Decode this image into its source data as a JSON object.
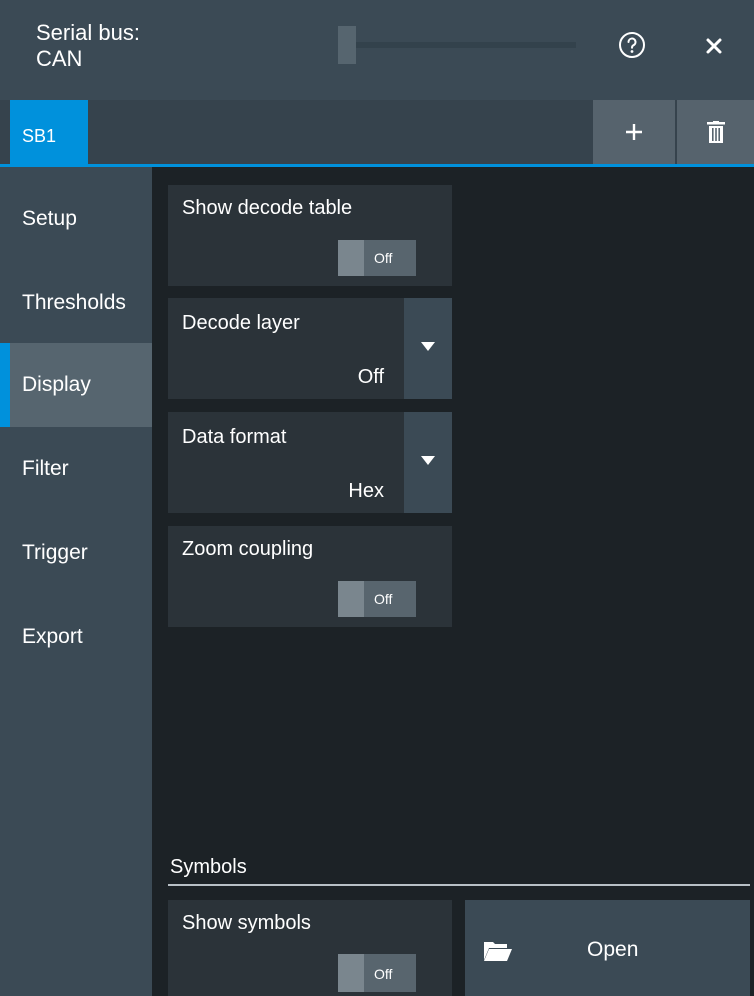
{
  "dialog": {
    "title_line1": "Serial bus:",
    "title_line2": "CAN"
  },
  "tabs": [
    {
      "label": "SB1",
      "active": true
    }
  ],
  "sidebar": {
    "items": [
      {
        "label": "Setup"
      },
      {
        "label": "Thresholds"
      },
      {
        "label": "Display",
        "active": true
      },
      {
        "label": "Filter"
      },
      {
        "label": "Trigger"
      },
      {
        "label": "Export"
      }
    ]
  },
  "settings": {
    "show_decode_table": {
      "label": "Show decode table",
      "state": "Off"
    },
    "decode_layer": {
      "label": "Decode layer",
      "value": "Off"
    },
    "data_format": {
      "label": "Data format",
      "value": "Hex"
    },
    "zoom_coupling": {
      "label": "Zoom coupling",
      "state": "Off"
    }
  },
  "symbols": {
    "heading": "Symbols",
    "show_symbols": {
      "label": "Show symbols",
      "state": "Off"
    },
    "open_label": "Open"
  },
  "colors": {
    "accent": "#0091dc",
    "sidebar": "#3b4a55",
    "panel": "#2b3339",
    "background": "#1c2226"
  },
  "icons": [
    "help-icon",
    "close-icon",
    "plus-icon",
    "trash-icon",
    "chevron-down-icon",
    "folder-open-icon"
  ]
}
